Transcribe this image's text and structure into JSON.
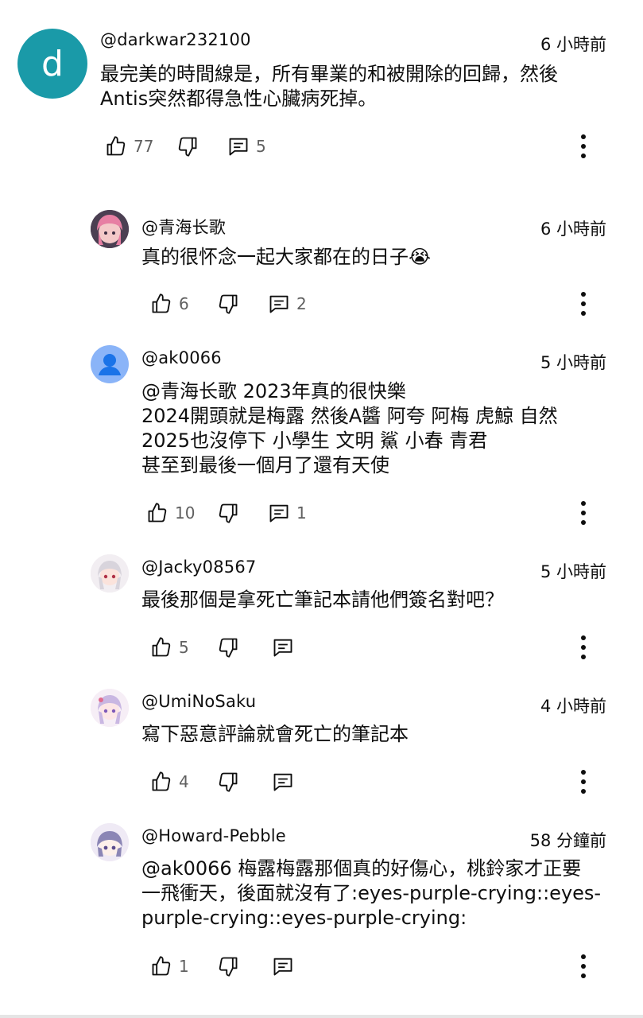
{
  "comments": [
    {
      "handle": "@darkwar232100",
      "time": "6 小時前",
      "avatar_letter": "d",
      "avatar_color": "#1a9aa8",
      "lines": [
        "最完美的時間線是，所有畢業的和被開除的回歸，然後",
        "Antis突然都得急性心臟病死掉。"
      ],
      "likes": "77",
      "replies": "5"
    },
    {
      "handle": "@青海长歌",
      "time": "6 小時前",
      "avatar_desc": "anime-avatar-pink-hair",
      "lines": [
        "真的很怀念一起大家都在的日子😭"
      ],
      "likes": "6",
      "replies": "2"
    },
    {
      "handle": "@ak0066",
      "time": "5 小時前",
      "avatar_desc": "default-person-avatar",
      "avatar_color": "#8ab4f8",
      "lines": [
        " @青海长歌  2023年真的很快樂",
        "2024開頭就是梅露 然後A醬 阿夸 阿梅 虎鯨 自然",
        "2025也沒停下 小學生 文明 鯊 小春 青君",
        "甚至到最後一個月了還有天使"
      ],
      "likes": "10",
      "replies": "1"
    },
    {
      "handle": "@Jacky08567",
      "time": "5 小時前",
      "avatar_desc": "anime-avatar-white-hair",
      "lines": [
        "最後那個是拿死亡筆記本請他們簽名對吧？"
      ],
      "likes": "5",
      "replies": ""
    },
    {
      "handle": "@UmiNoSaku",
      "time": "4 小時前",
      "avatar_desc": "anime-avatar-lavender-hair",
      "lines": [
        "寫下惡意評論就會死亡的筆記本"
      ],
      "likes": "4",
      "replies": ""
    },
    {
      "handle": "@Howard-Pebble",
      "time": "58 分鐘前",
      "avatar_desc": "anime-avatar-purple-chibi",
      "lines": [
        "@ak0066 梅露梅露那個真的好傷心，桃鈴家才正要",
        "一飛衝天，後面就沒有了:eyes-purple-crying::eyes-",
        "purple-crying::eyes-purple-crying:"
      ],
      "likes": "1",
      "replies": ""
    }
  ],
  "colors": {
    "text": "#0f0f0f",
    "secondary": "#606060"
  }
}
